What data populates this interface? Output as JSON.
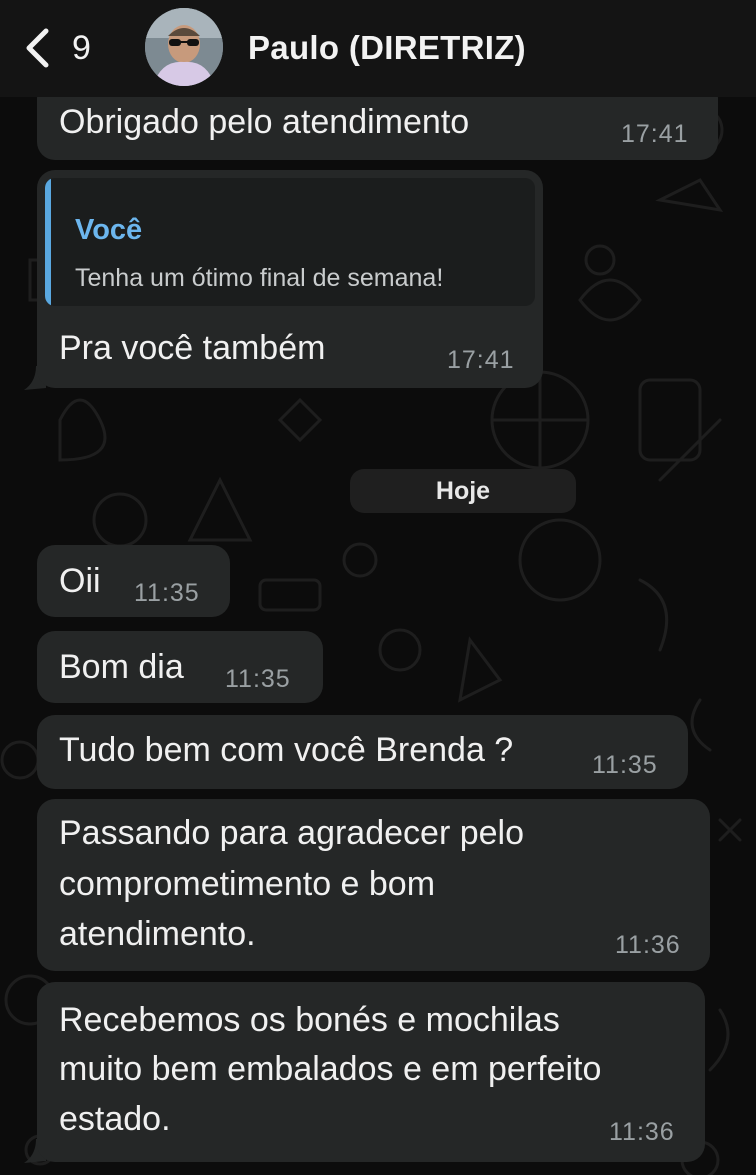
{
  "header": {
    "back_count": "9",
    "title": "Paulo (DIRETRIZ)"
  },
  "messages": [
    {
      "text": "Obrigado pelo atendimento",
      "time": "17:41"
    },
    {
      "reply": {
        "author": "Você",
        "text": "Tenha um ótimo final de semana!"
      },
      "text": "Pra você também",
      "time": "17:41"
    },
    {
      "text": "Oii",
      "time": "11:35"
    },
    {
      "text": "Bom dia",
      "time": "11:35"
    },
    {
      "text": "Tudo bem com você Brenda ?",
      "time": "11:35"
    },
    {
      "lines": [
        "Passando para agradecer pelo",
        "comprometimento e bom",
        "atendimento."
      ],
      "time": "11:36"
    },
    {
      "lines": [
        "Recebemos os bonés e mochilas",
        "muito bem embalados e em perfeito",
        "estado."
      ],
      "time": "11:36"
    }
  ],
  "date_separator": "Hoje",
  "colors": {
    "background": "#0c0c0c",
    "bubble": "#252727",
    "quote_accent": "#5aa8e0",
    "timestamp": "#9aa0a3"
  }
}
